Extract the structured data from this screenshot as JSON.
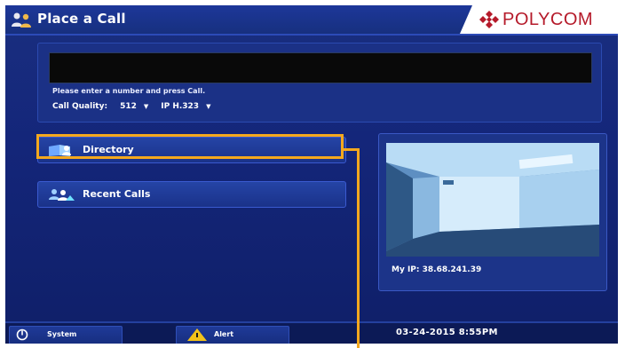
{
  "header": {
    "title": "Place a Call",
    "brand": "POLYCOM",
    "title_icon": "people-icon",
    "brand_icon": "polycom-logo-icon",
    "brand_color": "#b51a2a"
  },
  "dial": {
    "number_value": "",
    "prompt": "Please enter a number and press Call.",
    "quality_label": "Call Quality:",
    "quality_value": "512",
    "protocol_value": "IP H.323",
    "dropdown_icon": "caret-down-icon"
  },
  "menu": {
    "directory_label": "Directory",
    "directory_icon": "directory-book-icon",
    "recent_label": "Recent Calls",
    "recent_icon": "recent-calls-icon"
  },
  "preview": {
    "ip_text": "My IP: 38.68.241.39"
  },
  "footer": {
    "system_label": "System",
    "system_icon": "power-icon",
    "alert_label": "Alert",
    "alert_icon": "warning-icon",
    "datetime": "03-24-2015  8:55PM"
  },
  "colors": {
    "background": "#14267a",
    "highlight": "#f4a81e",
    "panel": "#1b3186"
  }
}
